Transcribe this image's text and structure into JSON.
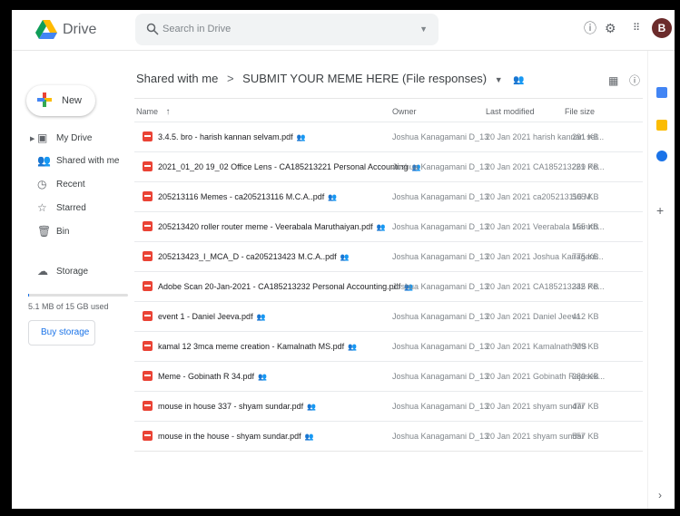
{
  "app": {
    "title": "Drive",
    "avatar_letter": "B"
  },
  "search": {
    "placeholder": "Search in Drive"
  },
  "sidebar": {
    "new_label": "New",
    "items": [
      {
        "label": "My Drive",
        "icon": "my-drive-icon"
      },
      {
        "label": "Shared with me",
        "icon": "people-icon"
      },
      {
        "label": "Recent",
        "icon": "clock-icon"
      },
      {
        "label": "Starred",
        "icon": "star-icon"
      },
      {
        "label": "Bin",
        "icon": "trash-icon"
      },
      {
        "label": "Storage",
        "icon": "cloud-icon"
      }
    ],
    "storage_used_text": "5.1 MB of 15 GB used",
    "buy_storage_label": "Buy storage"
  },
  "breadcrumb": {
    "root": "Shared with me",
    "separator": ">",
    "current": "SUBMIT YOUR MEME HERE (File responses)"
  },
  "columns": {
    "name": "Name",
    "owner": "Owner",
    "modified": "Last modified",
    "size": "File size"
  },
  "files": [
    {
      "name": "3.4.5. bro - harish kannan selvam.pdf",
      "owner": "Joshua Kanagamani D_13",
      "modified": "20 Jan 2021 harish kannan sel...",
      "size": "291 KB"
    },
    {
      "name": "2021_01_20 19_02 Office Lens - CA185213221 Personal Accounting",
      "owner": "Joshua Kanagamani D_13",
      "modified": "20 Jan 2021 CA185213221 Pe...",
      "size": "269 KB"
    },
    {
      "name": "205213116 Memes - ca205213116 M.C.A..pdf",
      "owner": "Joshua Kanagamani D_13",
      "modified": "20 Jan 2021 ca205213116 M...",
      "size": "505 KB"
    },
    {
      "name": "205213420 roller router meme - Veerabala Maruthaiyan.pdf",
      "owner": "Joshua Kanagamani D_13",
      "modified": "20 Jan 2021 Veerabala Maruth...",
      "size": "155 KB"
    },
    {
      "name": "205213423_I_MCA_D - ca205213423 M.C.A..pdf",
      "owner": "Joshua Kanagamani D_13",
      "modified": "20 Jan 2021 Joshua Kanagam...",
      "size": "775 KB"
    },
    {
      "name": "Adobe Scan 20-Jan-2021 - CA185213232 Personal Accounting.pdf",
      "owner": "Joshua Kanagamani D_13",
      "modified": "20 Jan 2021 CA185213232 Pe...",
      "size": "345 KB"
    },
    {
      "name": "event 1 - Daniel Jeeva.pdf",
      "owner": "Joshua Kanagamani D_13",
      "modified": "20 Jan 2021 Daniel Jeeva",
      "size": "412 KB"
    },
    {
      "name": "kamal 12 3mca meme creation - Kamalnath MS.pdf",
      "owner": "Joshua Kanagamani D_13",
      "modified": "20 Jan 2021 Kamalnath MS",
      "size": "509 KB"
    },
    {
      "name": "Meme - Gobinath R 34.pdf",
      "owner": "Joshua Kanagamani D_13",
      "modified": "20 Jan 2021 Gobinath Rajasek...",
      "size": "280 KB"
    },
    {
      "name": "mouse in house 337 - shyam sundar.pdf",
      "owner": "Joshua Kanagamani D_13",
      "modified": "20 Jan 2021 shyam sundar",
      "size": "477 KB"
    },
    {
      "name": "mouse in the house - shyam sundar.pdf",
      "owner": "Joshua Kanagamani D_13",
      "modified": "20 Jan 2021 shyam sundar",
      "size": "557 KB"
    }
  ],
  "colors": {
    "accent": "#1a73e8",
    "pdf": "#ea4335"
  }
}
